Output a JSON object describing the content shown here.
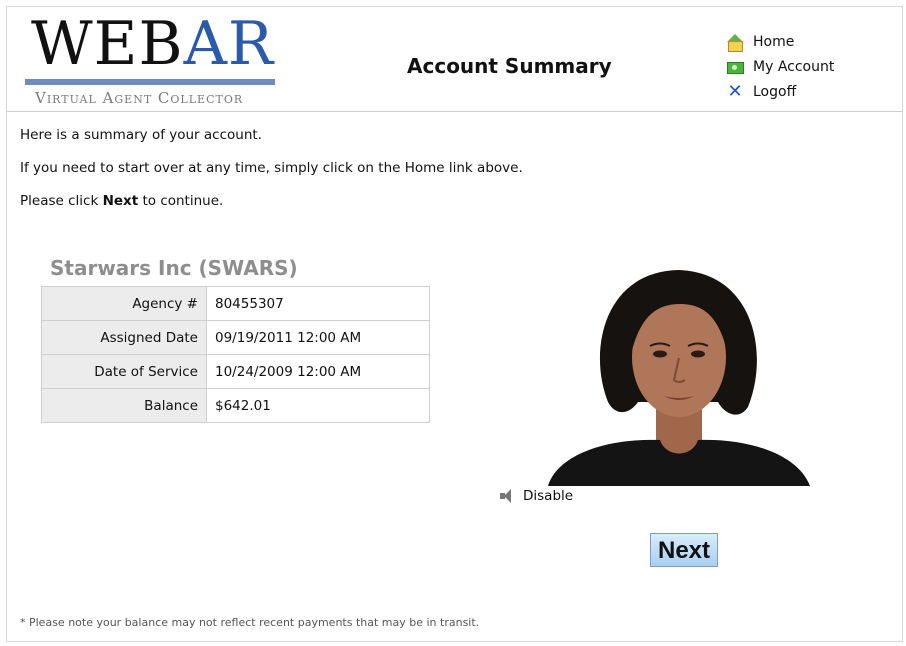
{
  "logo": {
    "word_part1": "WEB",
    "word_part2": "AR",
    "subtitle": "Virtual Agent Collector",
    "accent_color": "#2a5aa8"
  },
  "header": {
    "title": "Account Summary"
  },
  "nav": [
    {
      "label": "Home",
      "icon": "home-icon"
    },
    {
      "label": "My Account",
      "icon": "account-icon"
    },
    {
      "label": "Logoff",
      "icon": "logoff-icon"
    }
  ],
  "intro": {
    "line1": "Here is a summary of your account.",
    "line2": "If you need to start over at any time, simply click on the Home link above.",
    "line3_before": "Please click ",
    "line3_bold": "Next",
    "line3_after": " to continue."
  },
  "company": "Starwars Inc (SWARS)",
  "summary": [
    {
      "label": "Agency #",
      "value": "80455307"
    },
    {
      "label": "Assigned Date",
      "value": "09/19/2011 12:00 AM"
    },
    {
      "label": "Date of Service",
      "value": "10/24/2009 12:00 AM"
    },
    {
      "label": "Balance",
      "value": "$642.01"
    }
  ],
  "audio": {
    "label": "Disable",
    "icon": "speaker-icon"
  },
  "next_button": "Next",
  "footnote": "* Please note your balance may not reflect recent payments that may be in transit."
}
